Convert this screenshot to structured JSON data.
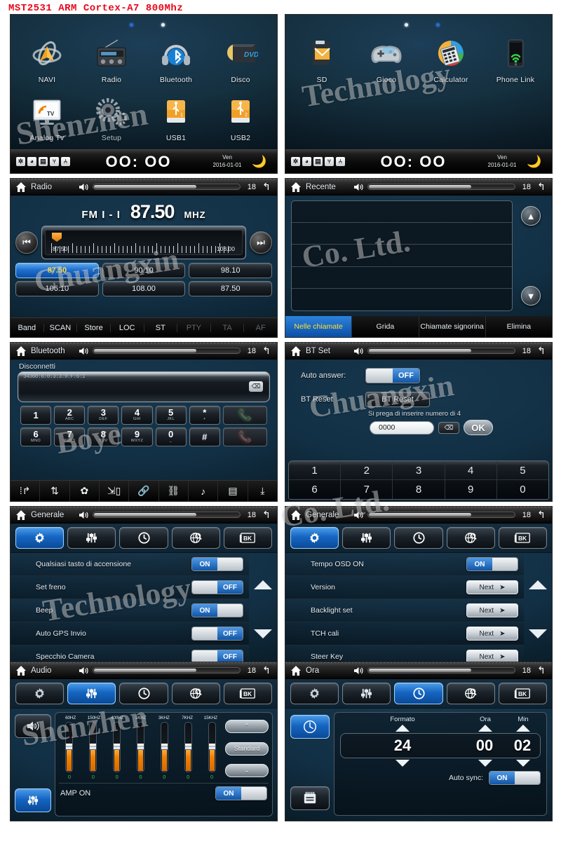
{
  "model_caption": "MST2531 ARM Cortex-A7 800Mhz",
  "watermark": {
    "lines": [
      "Shenzhen",
      "Technology",
      "Chuangxin",
      "Co. Ltd.",
      "Boye",
      "Chuangxin",
      "Technology",
      "Co. Ltd.",
      "Shenzhen"
    ]
  },
  "home": {
    "status": {
      "icons": [
        "bluetooth-icon",
        "power-icon",
        "list-icon",
        "tree-icon",
        "network-icon"
      ],
      "clock": "OO: OO",
      "day": "Ven",
      "date": "2016-01-01",
      "night_icon": "moon-star-icon"
    },
    "page1": {
      "apps": [
        {
          "label": "NAVI",
          "icon": "navi-icon"
        },
        {
          "label": "Radio",
          "icon": "radio-icon"
        },
        {
          "label": "Bluetooth",
          "icon": "bluetooth-headset-icon"
        },
        {
          "label": "Disco",
          "icon": "dvd-drive-icon"
        },
        {
          "label": "Analog Tv",
          "icon": "tv-icon"
        },
        {
          "label": "Setup",
          "icon": "gears-icon"
        },
        {
          "label": "USB1",
          "icon": "usb-drive-icon"
        },
        {
          "label": "USB2",
          "icon": "usb-drive-icon"
        }
      ]
    },
    "page2": {
      "apps": [
        {
          "label": "SD",
          "icon": "sd-card-icon"
        },
        {
          "label": "Gioco",
          "icon": "gamepad-icon"
        },
        {
          "label": "Calculator",
          "icon": "calculator-icon"
        },
        {
          "label": "Phone Link",
          "icon": "phone-link-icon"
        }
      ]
    }
  },
  "header": {
    "home_icon": "home-icon",
    "speaker_icon": "speaker-icon",
    "back_icon": "back-arrow-icon",
    "volume_value": "18",
    "volume_percent": 70
  },
  "radio": {
    "title": "Radio",
    "band": "FM I - I",
    "frequency": "87.50",
    "unit": "MHZ",
    "scale_low": "87.50",
    "scale_high": "108.00",
    "prev_icon": "prev-track-icon",
    "next_icon": "next-track-icon",
    "presets": [
      {
        "value": "87.50",
        "active": true
      },
      {
        "value": "90.10",
        "active": false
      },
      {
        "value": "98.10",
        "active": false
      },
      {
        "value": "106.10",
        "active": false
      },
      {
        "value": "108.00",
        "active": false
      },
      {
        "value": "87.50",
        "active": false
      }
    ],
    "functions": [
      {
        "label": "Band",
        "enabled": true
      },
      {
        "label": "SCAN",
        "enabled": true
      },
      {
        "label": "Store",
        "enabled": true
      },
      {
        "label": "LOC",
        "enabled": true
      },
      {
        "label": "ST",
        "enabled": true
      },
      {
        "label": "PTY",
        "enabled": false
      },
      {
        "label": "TA",
        "enabled": false
      },
      {
        "label": "AF",
        "enabled": false
      }
    ]
  },
  "recent": {
    "title": "Recente",
    "scroll_up_icon": "scroll-up-icon",
    "scroll_down_icon": "scroll-down-icon",
    "rows": [
      "",
      "",
      "",
      "",
      ""
    ],
    "tabs": [
      {
        "label": "Nelle chiamate",
        "active": true
      },
      {
        "label": "Grida",
        "active": false
      },
      {
        "label": "Chiamate signorina",
        "active": false
      },
      {
        "label": "Elimina",
        "active": false
      }
    ]
  },
  "bluetooth": {
    "title": "Bluetooth",
    "status": "Disconnetti",
    "number_field": "34360:6:0:3:3:9:F:6:1",
    "delete_icon": "backspace-icon",
    "keys": [
      {
        "digit": "1",
        "sub": ""
      },
      {
        "digit": "2",
        "sub": "ABC"
      },
      {
        "digit": "3",
        "sub": "DEF"
      },
      {
        "digit": "4",
        "sub": "GHI"
      },
      {
        "digit": "5",
        "sub": "JKL"
      },
      {
        "digit": "*",
        "sub": "+"
      },
      {
        "digit": "6",
        "sub": "MNO"
      },
      {
        "digit": "7",
        "sub": "PQRS"
      },
      {
        "digit": "8",
        "sub": "TUV"
      },
      {
        "digit": "9",
        "sub": "WXYZ"
      },
      {
        "digit": "0",
        "sub": "_"
      },
      {
        "digit": "#",
        "sub": ""
      }
    ],
    "call_icon": "call-answer-icon",
    "end_icon": "call-end-icon",
    "toolbar": [
      "keypad-icon",
      "call-transfer-icon",
      "bt-settings-icon",
      "phone-sync-icon",
      "link-connect-icon",
      "link-disconnect-icon",
      "bt-music-icon",
      "contacts-icon",
      "download-contacts-icon"
    ]
  },
  "bt_set": {
    "title": "BT Set",
    "auto_answer_label": "Auto answer:",
    "auto_answer_state": "OFF",
    "bt_reset_label": "BT Reset",
    "bt_reset_button": "BT Reset",
    "pin_hint": "Si prega di inserire numero di 4",
    "pin_value": "0000",
    "pin_delete_icon": "backspace-icon",
    "ok_label": "OK",
    "keypad": [
      [
        "1",
        "2",
        "3",
        "4",
        "5"
      ],
      [
        "6",
        "7",
        "8",
        "9",
        "0"
      ]
    ]
  },
  "settings_tabs": [
    {
      "icon": "gear-icon",
      "name": "general"
    },
    {
      "icon": "equalizer-icon",
      "name": "audio"
    },
    {
      "icon": "clock-icon",
      "name": "time"
    },
    {
      "icon": "globe-search-icon",
      "name": "language"
    },
    {
      "icon": "bk-icon",
      "name": "bk",
      "label": "BK"
    }
  ],
  "generale_1": {
    "title": "Generale",
    "active_tab": 0,
    "rows": [
      {
        "label": "Qualsiasi tasto di accensione",
        "control": "toggle",
        "state": "ON"
      },
      {
        "label": "Set freno",
        "control": "toggle",
        "state": "OFF"
      },
      {
        "label": "Beep",
        "control": "toggle",
        "state": "ON"
      },
      {
        "label": "Auto GPS Invio",
        "control": "toggle",
        "state": "OFF"
      },
      {
        "label": "Specchio Camera",
        "control": "toggle",
        "state": "OFF"
      }
    ],
    "up_icon": "triangle-up-icon",
    "down_icon": "triangle-down-icon"
  },
  "generale_2": {
    "title": "Generale",
    "active_tab": 0,
    "rows": [
      {
        "label": "Tempo OSD ON",
        "control": "toggle",
        "state": "ON"
      },
      {
        "label": "Version",
        "control": "next",
        "state": "Next"
      },
      {
        "label": "Backlight set",
        "control": "next",
        "state": "Next"
      },
      {
        "label": "TCH cali",
        "control": "next",
        "state": "Next"
      },
      {
        "label": "Steer Key",
        "control": "next",
        "state": "Next"
      }
    ],
    "up_icon": "triangle-up-icon",
    "down_icon": "triangle-down-icon"
  },
  "audio": {
    "title": "Audio",
    "active_tab": 1,
    "side_buttons": [
      {
        "icon": "speaker-loud-icon",
        "active": false
      },
      {
        "icon": "equalizer-icon",
        "active": true
      }
    ],
    "bands": [
      "60HZ",
      "150HZ",
      "400HZ",
      "1KHZ",
      "3KHZ",
      "7KHZ",
      "15KHZ"
    ],
    "values": [
      "0",
      "0",
      "0",
      "0",
      "0",
      "0",
      "0"
    ],
    "preset_up_icon": "chevron-up-icon",
    "preset_name": "Standard",
    "preset_down_icon": "chevron-down-icon",
    "amp_label": "AMP ON",
    "amp_state": "ON"
  },
  "ora": {
    "title": "Ora",
    "active_tab": 2,
    "side_buttons": [
      {
        "icon": "clock-face-icon",
        "active": true
      },
      {
        "icon": "calendar-icon",
        "active": false
      }
    ],
    "col_headers": {
      "format": "Formato",
      "hour": "Ora",
      "minute": "Min"
    },
    "format_value": "24",
    "hour_value": "00",
    "minute_value": "02",
    "up_icon": "triangle-up-icon",
    "down_icon": "triangle-down-icon",
    "autosync_label": "Auto sync:",
    "autosync_state": "ON"
  }
}
